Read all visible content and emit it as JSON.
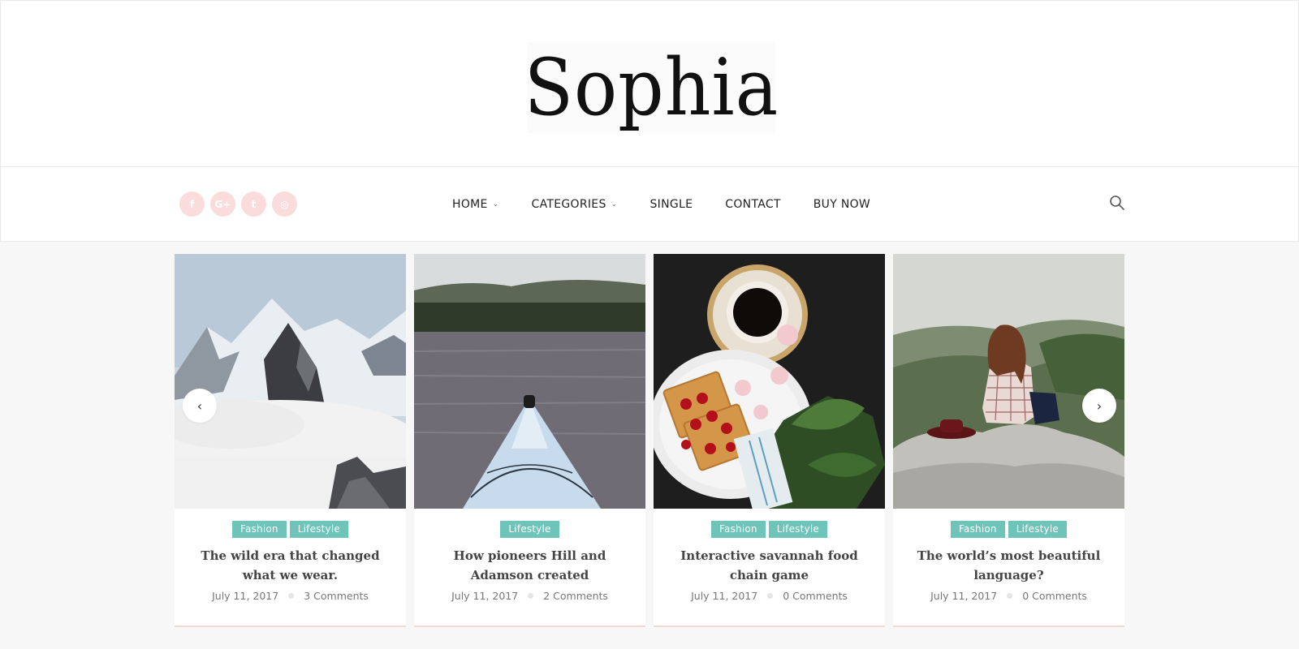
{
  "site": {
    "logo": "Sophia"
  },
  "social": [
    {
      "icon": "facebook-icon",
      "glyph": "f"
    },
    {
      "icon": "google-plus-icon",
      "glyph": "G+"
    },
    {
      "icon": "twitter-icon",
      "glyph": "t"
    },
    {
      "icon": "instagram-icon",
      "glyph": "◎"
    }
  ],
  "nav": {
    "items": [
      {
        "label": "HOME",
        "dropdown": true
      },
      {
        "label": "CATEGORIES",
        "dropdown": true
      },
      {
        "label": "SINGLE",
        "dropdown": false
      },
      {
        "label": "CONTACT",
        "dropdown": false
      },
      {
        "label": "BUY NOW",
        "dropdown": false
      }
    ]
  },
  "slider": {
    "prev_label": "‹",
    "next_label": "›",
    "posts": [
      {
        "image": "snowy-mountain-peaks",
        "tags": [
          "Fashion",
          "Lifestyle"
        ],
        "title": "The wild era that changed what we wear.",
        "date": "July 11, 2017",
        "comments": "3 Comments"
      },
      {
        "image": "kayak-on-lake",
        "tags": [
          "Lifestyle"
        ],
        "title": "How pioneers Hill and Adamson created",
        "date": "July 11, 2017",
        "comments": "2 Comments"
      },
      {
        "image": "coffee-waffles-flowers",
        "tags": [
          "Fashion",
          "Lifestyle"
        ],
        "title": "Interactive savannah food chain game",
        "date": "July 11, 2017",
        "comments": "0 Comments"
      },
      {
        "image": "woman-on-cliff-fog",
        "tags": [
          "Fashion",
          "Lifestyle"
        ],
        "title": "The world’s most beautiful language?",
        "date": "July 11, 2017",
        "comments": "0 Comments"
      }
    ]
  },
  "colors": {
    "tag_bg": "#6ec4b9",
    "social_bg": "#fbdcdc",
    "page_bg": "#f7f7f7"
  }
}
